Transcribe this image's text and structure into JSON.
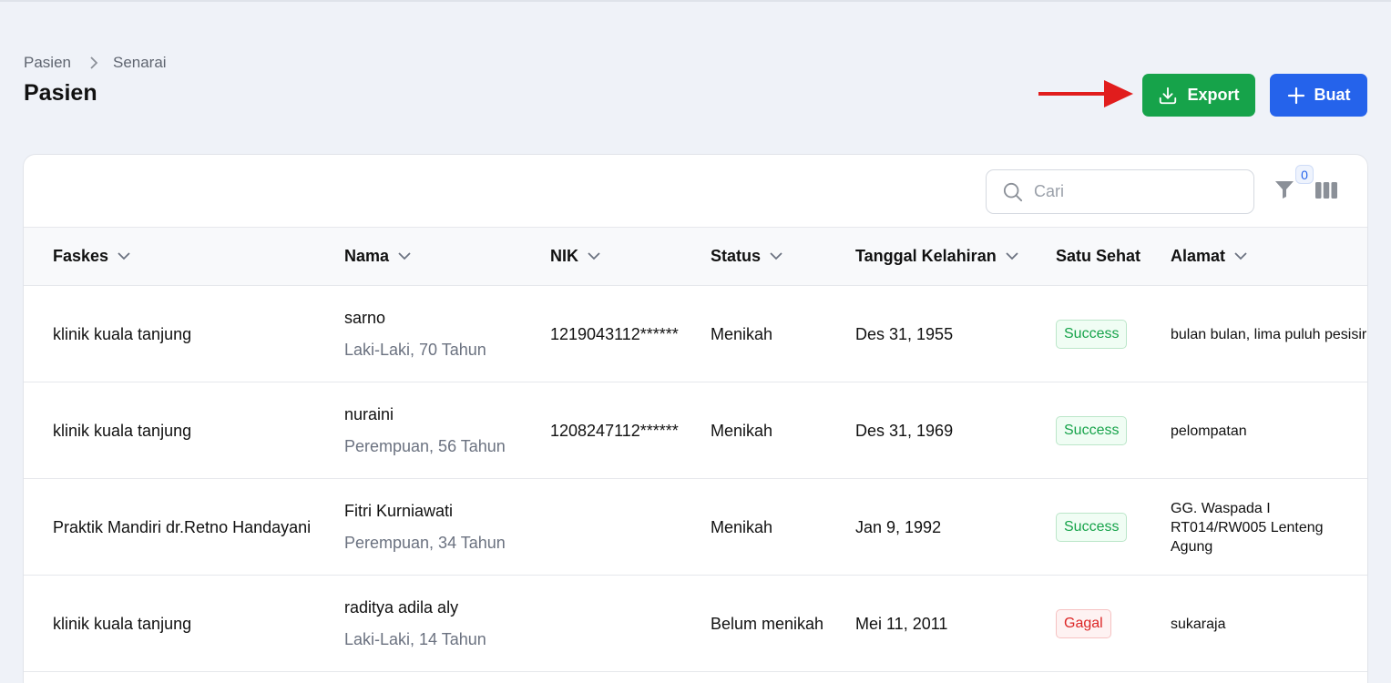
{
  "breadcrumb": {
    "parent": "Pasien",
    "current": "Senarai"
  },
  "page_title": "Pasien",
  "actions": {
    "export_label": "Export",
    "create_label": "Buat"
  },
  "search": {
    "placeholder": "Cari",
    "value": ""
  },
  "filter": {
    "count": "0"
  },
  "table": {
    "headers": {
      "faskes": "Faskes",
      "nama": "Nama",
      "nik": "NIK",
      "status": "Status",
      "tanggal": "Tanggal Kelahiran",
      "satu_sehat": "Satu Sehat",
      "alamat": "Alamat"
    },
    "rows": [
      {
        "faskes": "klinik kuala tanjung",
        "nama": "sarno",
        "detail": "Laki-Laki, 70 Tahun",
        "nik": "1219043112******",
        "status": "Menikah",
        "tanggal": "Des 31, 1955",
        "satu_sehat": "Success",
        "alamat": "bulan bulan, lima puluh pesisir"
      },
      {
        "faskes": "klinik kuala tanjung",
        "nama": "nuraini",
        "detail": "Perempuan, 56 Tahun",
        "nik": "1208247112******",
        "status": "Menikah",
        "tanggal": "Des 31, 1969",
        "satu_sehat": "Success",
        "alamat": "pelompatan"
      },
      {
        "faskes": "Praktik Mandiri dr.Retno Handayani",
        "nama": "Fitri Kurniawati",
        "detail": "Perempuan, 34 Tahun",
        "nik": "",
        "status": "Menikah",
        "tanggal": "Jan 9, 1992",
        "satu_sehat": "Success",
        "alamat": "GG. Waspada I RT014/RW005 Lenteng Agung"
      },
      {
        "faskes": "klinik kuala tanjung",
        "nama": "raditya adila aly",
        "detail": "Laki-Laki, 14 Tahun",
        "nik": "",
        "status": "Belum menikah",
        "tanggal": "Mei 11, 2011",
        "satu_sehat": "Gagal",
        "alamat": "sukaraja"
      }
    ]
  },
  "colors": {
    "export": "#16a34a",
    "create": "#2563eb",
    "success": "#16a34a",
    "fail": "#dc2626",
    "arrow": "#e11d1d"
  },
  "icons": {
    "export": "download-icon",
    "create": "plus-icon",
    "search": "search-icon",
    "filter": "filter-icon",
    "columns": "columns-icon",
    "sort": "chevron-down-icon",
    "breadcrumb": "chevron-right-icon",
    "annotation": "red-arrow-annotation"
  }
}
